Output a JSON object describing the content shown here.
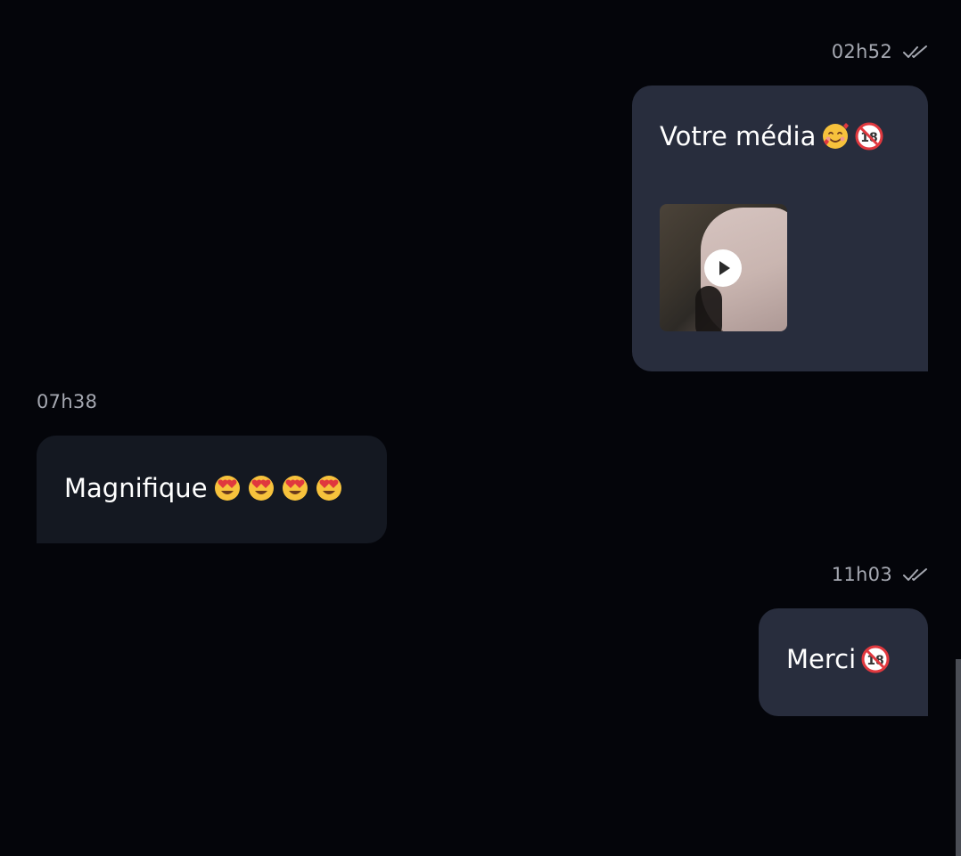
{
  "messages": [
    {
      "direction": "outgoing",
      "time": "02h52",
      "status": "read",
      "text": "Votre média",
      "emojis": [
        "smiling-face-with-hearts",
        "no-one-under-eighteen"
      ],
      "has_media": true,
      "media_type": "video"
    },
    {
      "direction": "incoming",
      "time": "07h38",
      "text": "Magnifique",
      "emojis": [
        "heart-eyes",
        "heart-eyes",
        "heart-eyes",
        "heart-eyes"
      ]
    },
    {
      "direction": "outgoing",
      "time": "11h03",
      "status": "read",
      "text": "Merci",
      "emojis": [
        "no-one-under-eighteen"
      ]
    }
  ],
  "colors": {
    "background": "#04050a",
    "outgoing_bubble": "#282d3d",
    "incoming_bubble": "#141821",
    "timestamp": "#a5a8b1",
    "text": "#ffffff"
  }
}
